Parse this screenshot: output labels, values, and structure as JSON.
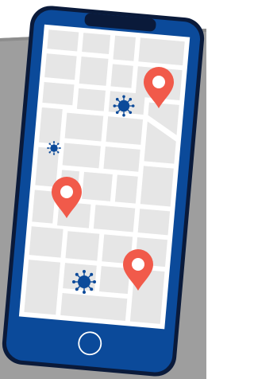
{
  "illustration": {
    "subject": "smartphone-map",
    "icons": {
      "map_pins": [
        "map-pin-icon",
        "map-pin-icon",
        "map-pin-icon"
      ],
      "virus_markers": [
        "virus-icon",
        "virus-icon",
        "virus-icon"
      ],
      "home_button": "home-button-icon"
    },
    "colors": {
      "background": "#ffffff",
      "backdrop_shape": "#9e9e9e",
      "phone_body": "#0b4a9a",
      "phone_outline": "#0a1a3a",
      "screen": "#ffffff",
      "map_block": "#e6e6e6",
      "pin": "#f15a4a",
      "virus": "#0b4a9a"
    }
  }
}
